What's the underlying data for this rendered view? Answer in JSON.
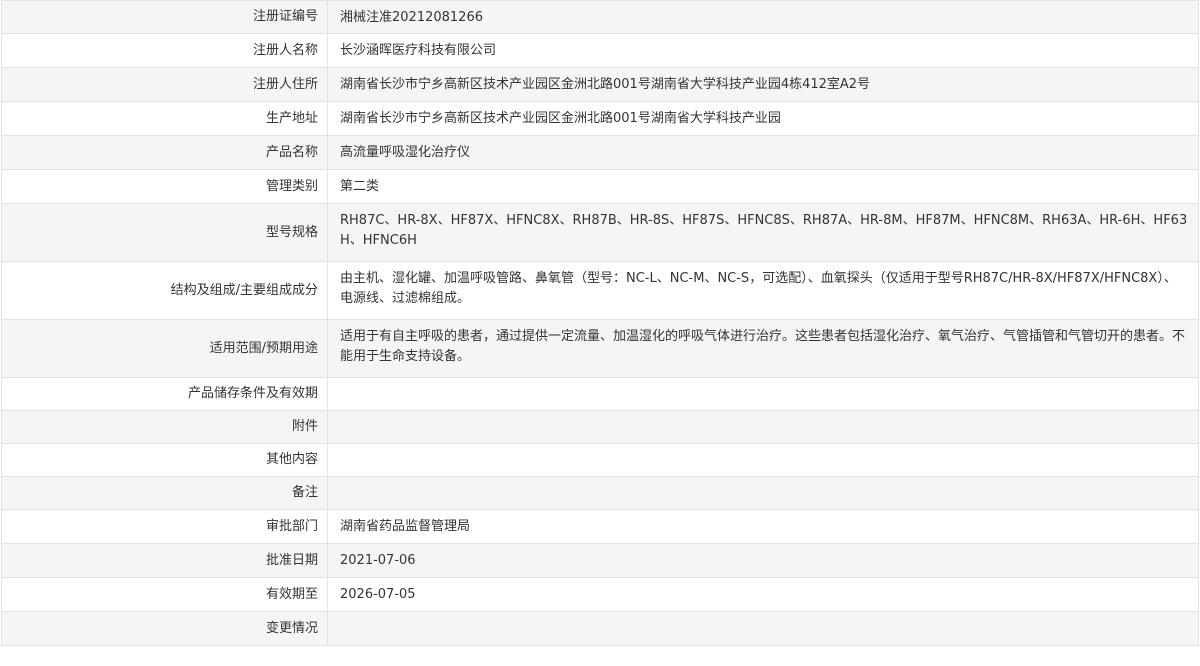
{
  "rows": [
    {
      "label": "注册证编号",
      "value": "湘械注准20212081266"
    },
    {
      "label": "注册人名称",
      "value": "长沙涵晖医疗科技有限公司"
    },
    {
      "label": "注册人住所",
      "value": "湖南省长沙市宁乡高新区技术产业园区金洲北路001号湖南省大学科技产业园4栋412室A2号"
    },
    {
      "label": "生产地址",
      "value": "湖南省长沙市宁乡高新区技术产业园区金洲北路001号湖南省大学科技产业园"
    },
    {
      "label": "产品名称",
      "value": "高流量呼吸湿化治疗仪"
    },
    {
      "label": "管理类别",
      "value": "第二类"
    },
    {
      "label": "型号规格",
      "value": "RH87C、HR-8X、HF87X、HFNC8X、RH87B、HR-8S、HF87S、HFNC8S、RH87A、HR-8M、HF87M、HFNC8M、RH63A、HR-6H、HF63H、HFNC6H"
    },
    {
      "label": "结构及组成/主要组成成分",
      "value": "由主机、湿化罐、加温呼吸管路、鼻氧管（型号：NC-L、NC-M、NC-S，可选配）、血氧探头（仅适用于型号RH87C/HR-8X/HF87X/HFNC8X）、电源线、过滤棉组成。"
    },
    {
      "label": "适用范围/预期用途",
      "value": "适用于有自主呼吸的患者，通过提供一定流量、加温湿化的呼吸气体进行治疗。这些患者包括湿化治疗、氧气治疗、气管插管和气管切开的患者。不能用于生命支持设备。"
    },
    {
      "label": "产品储存条件及有效期",
      "value": ""
    },
    {
      "label": "附件",
      "value": ""
    },
    {
      "label": "其他内容",
      "value": ""
    },
    {
      "label": "备注",
      "value": ""
    },
    {
      "label": "审批部门",
      "value": "湖南省药品监督管理局"
    },
    {
      "label": "批准日期",
      "value": "2021-07-06"
    },
    {
      "label": "有效期至",
      "value": "2026-07-05"
    },
    {
      "label": "变更情况",
      "value": ""
    }
  ]
}
